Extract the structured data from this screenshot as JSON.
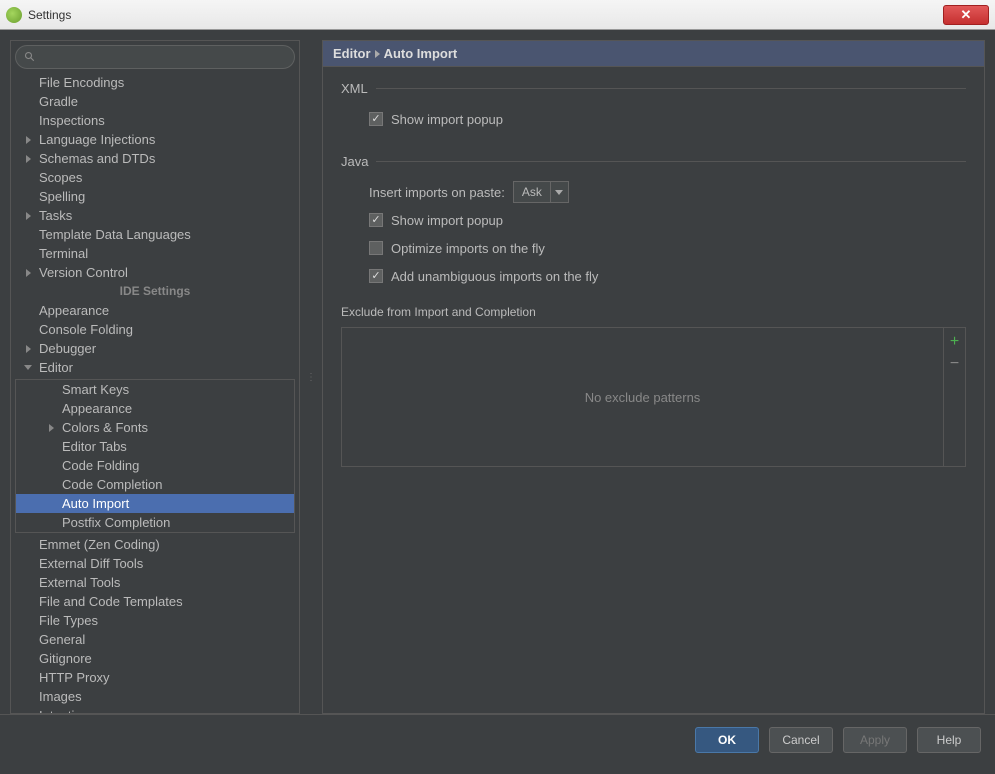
{
  "window": {
    "title": "Settings"
  },
  "sidebar": {
    "search_placeholder": "",
    "ide_settings_label": "IDE Settings",
    "items_top": [
      {
        "label": "File Encodings",
        "arrow": "none"
      },
      {
        "label": "Gradle",
        "arrow": "none"
      },
      {
        "label": "Inspections",
        "arrow": "none"
      },
      {
        "label": "Language Injections",
        "arrow": "right"
      },
      {
        "label": "Schemas and DTDs",
        "arrow": "right"
      },
      {
        "label": "Scopes",
        "arrow": "none"
      },
      {
        "label": "Spelling",
        "arrow": "none"
      },
      {
        "label": "Tasks",
        "arrow": "right"
      },
      {
        "label": "Template Data Languages",
        "arrow": "none"
      },
      {
        "label": "Terminal",
        "arrow": "none"
      },
      {
        "label": "Version Control",
        "arrow": "right"
      }
    ],
    "ide_items": [
      {
        "label": "Appearance",
        "arrow": "none",
        "depth": 0
      },
      {
        "label": "Console Folding",
        "arrow": "none",
        "depth": 0
      },
      {
        "label": "Debugger",
        "arrow": "right",
        "depth": 0
      },
      {
        "label": "Editor",
        "arrow": "down",
        "depth": 0
      },
      {
        "label": "Smart Keys",
        "arrow": "none",
        "depth": 1
      },
      {
        "label": "Appearance",
        "arrow": "none",
        "depth": 1
      },
      {
        "label": "Colors & Fonts",
        "arrow": "right",
        "depth": 1
      },
      {
        "label": "Editor Tabs",
        "arrow": "none",
        "depth": 1
      },
      {
        "label": "Code Folding",
        "arrow": "none",
        "depth": 1
      },
      {
        "label": "Code Completion",
        "arrow": "none",
        "depth": 1
      },
      {
        "label": "Auto Import",
        "arrow": "none",
        "depth": 1,
        "selected": true
      },
      {
        "label": "Postfix Completion",
        "arrow": "none",
        "depth": 1
      },
      {
        "label": "Emmet (Zen Coding)",
        "arrow": "none",
        "depth": 0,
        "after_group": true
      },
      {
        "label": "External Diff Tools",
        "arrow": "none",
        "depth": 0
      },
      {
        "label": "External Tools",
        "arrow": "none",
        "depth": 0
      },
      {
        "label": "File and Code Templates",
        "arrow": "none",
        "depth": 0
      },
      {
        "label": "File Types",
        "arrow": "none",
        "depth": 0
      },
      {
        "label": "General",
        "arrow": "none",
        "depth": 0
      },
      {
        "label": "Gitignore",
        "arrow": "none",
        "depth": 0
      },
      {
        "label": "HTTP Proxy",
        "arrow": "none",
        "depth": 0
      },
      {
        "label": "Images",
        "arrow": "none",
        "depth": 0
      },
      {
        "label": "Intentions",
        "arrow": "none",
        "depth": 0
      }
    ]
  },
  "breadcrumb": {
    "part1": "Editor",
    "part2": "Auto Import"
  },
  "panel": {
    "xml": {
      "title": "XML",
      "show_import_popup": "Show import popup",
      "show_import_popup_checked": true
    },
    "java": {
      "title": "Java",
      "insert_imports_label": "Insert imports on paste:",
      "insert_imports_value": "Ask",
      "show_import_popup": "Show import popup",
      "show_import_popup_checked": true,
      "optimize": "Optimize imports on the fly",
      "optimize_checked": false,
      "unambiguous": "Add unambiguous imports on the fly",
      "unambiguous_checked": true,
      "exclude_title": "Exclude from Import and Completion",
      "exclude_empty": "No exclude patterns"
    }
  },
  "footer": {
    "ok": "OK",
    "cancel": "Cancel",
    "apply": "Apply",
    "help": "Help"
  }
}
